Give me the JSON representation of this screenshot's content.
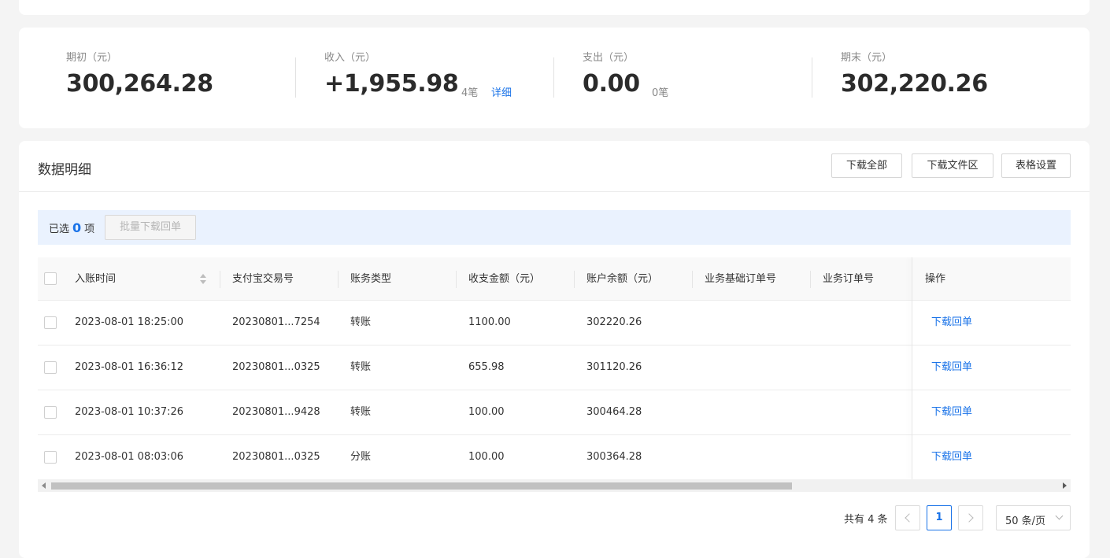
{
  "summary": {
    "opening": {
      "label": "期初（元）",
      "value": "300,264.28"
    },
    "income": {
      "label": "收入（元）",
      "value": "+1,955.98",
      "count": "4笔",
      "detail_link": "详细"
    },
    "expense": {
      "label": "支出（元）",
      "value": "0.00",
      "count": "0笔"
    },
    "closing": {
      "label": "期末（元）",
      "value": "302,220.26"
    }
  },
  "detail": {
    "title": "数据明细",
    "buttons": {
      "download_all": "下载全部",
      "download_area": "下载文件区",
      "table_settings": "表格设置"
    }
  },
  "selection": {
    "prefix": "已选",
    "count": "0",
    "suffix": "项",
    "batch_button": "批量下载回单"
  },
  "table": {
    "columns": [
      "入账时间",
      "支付宝交易号",
      "账务类型",
      "收支金额（元）",
      "账户余额（元）",
      "业务基础订单号",
      "业务订单号",
      "操作"
    ],
    "rows": [
      {
        "time": "2023-08-01 18:25:00",
        "trade_no": "20230801...7254",
        "type": "转账",
        "amount": "1100.00",
        "balance": "302220.26",
        "action": "下载回单"
      },
      {
        "time": "2023-08-01 16:36:12",
        "trade_no": "20230801...0325",
        "type": "转账",
        "amount": "655.98",
        "balance": "301120.26",
        "action": "下载回单"
      },
      {
        "time": "2023-08-01 10:37:26",
        "trade_no": "20230801...9428",
        "type": "转账",
        "amount": "100.00",
        "balance": "300464.28",
        "action": "下载回单"
      },
      {
        "time": "2023-08-01 08:03:06",
        "trade_no": "20230801...0325",
        "type": "分账",
        "amount": "100.00",
        "balance": "300364.28",
        "action": "下载回单"
      }
    ]
  },
  "pagination": {
    "total_text": "共有 4 条",
    "current_page": "1",
    "page_size": "50 条/页"
  },
  "colors": {
    "accent": "#1a73e8",
    "selection_bg": "#eaf2fe",
    "page_bg": "#f4f4f4"
  },
  "icons": [
    "sort-icon",
    "chevron-left-icon",
    "chevron-right-icon",
    "chevron-down-icon",
    "scroll-left-arrow-icon",
    "scroll-right-arrow-icon"
  ]
}
